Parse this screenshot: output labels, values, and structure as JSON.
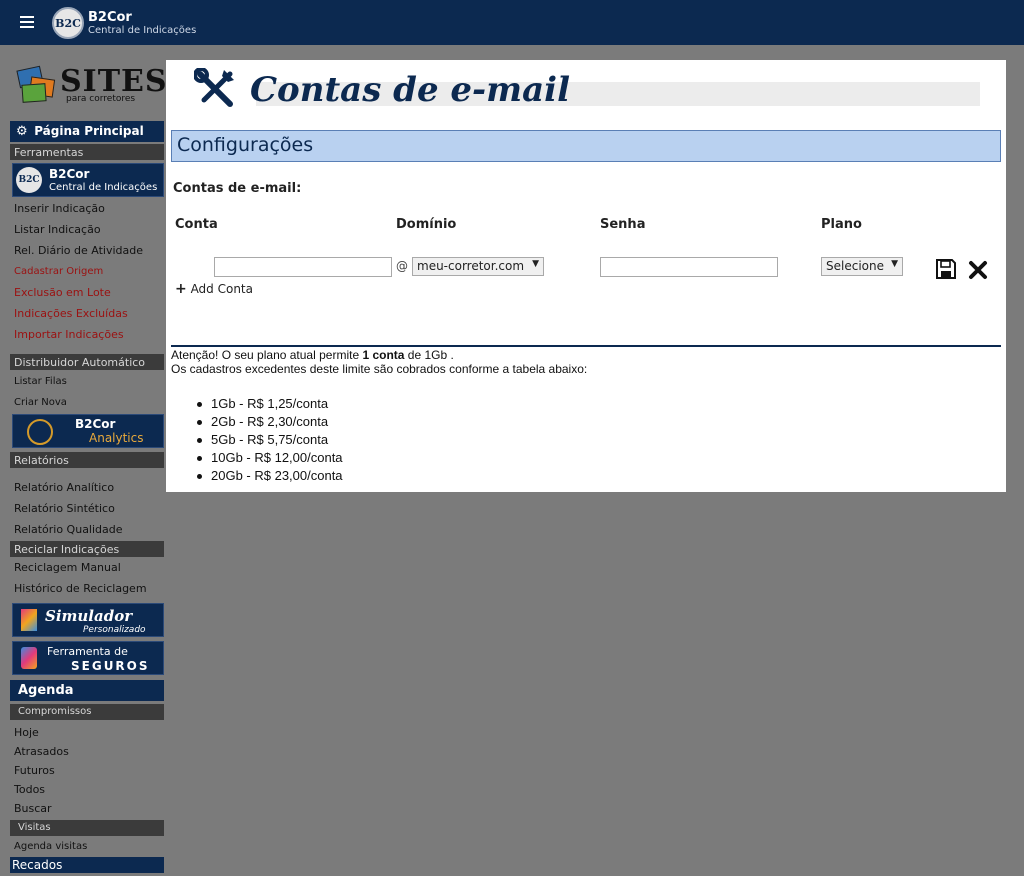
{
  "topbar": {
    "brand_title": "B2Cor",
    "brand_subtitle": "Central de Indicações",
    "logo_text": "B2C"
  },
  "sidebar": {
    "logo_word": "SITES",
    "logo_sub": "para corretores",
    "main_page": "Página Principal",
    "tools_header": "Ferramentas",
    "b2cor_banner": {
      "title": "B2Cor",
      "subtitle": "Central de Indicações",
      "logo_text": "B2C"
    },
    "tools_links": [
      "Inserir Indicação",
      "Listar Indicação",
      "Rel. Diário de Atividade"
    ],
    "red_links": [
      "Cadastrar Origem",
      "Exclusão em Lote",
      "Indicações Excluídas",
      "Importar Indicações"
    ],
    "distrib_header": "Distribuidor Automático",
    "distrib_links": [
      "Listar Filas",
      "Criar Nova"
    ],
    "analytics_banner": {
      "title": "B2Cor",
      "subtitle": "Analytics"
    },
    "reports_header": "Relatórios",
    "reports_links": [
      "Relatório Analítico",
      "Relatório Sintético",
      "Relatório Qualidade"
    ],
    "recycle_header": "Reciclar Indicações",
    "recycle_links": [
      "Reciclagem Manual",
      "Histórico de Reciclagem"
    ],
    "simulator_banner": {
      "title": "Simulador",
      "subtitle": "Personalizado"
    },
    "insurance_banner": {
      "title": "Ferramenta de",
      "subtitle": "SEGUROS"
    },
    "agenda_header": "Agenda",
    "commitments_header": "Compromissos",
    "agenda_links": [
      "Hoje",
      "Atrasados",
      "Futuros",
      "Todos",
      "Buscar"
    ],
    "visits_header": "Visitas",
    "visits_link": "Agenda visitas",
    "messages_header": "Recados"
  },
  "main": {
    "title": "Contas de e-mail",
    "section": "Configurações",
    "form_label": "Contas de e-mail:",
    "columns": [
      "Conta",
      "Domínio",
      "Senha",
      "Plano"
    ],
    "at_sign": "@",
    "account_value": "",
    "domain_value": "meu-corretor.com",
    "password_value": "",
    "plan_value": "Selecione",
    "add_account": "Add Conta",
    "notice_prefix": "Atenção! O seu plano atual permite ",
    "notice_bold": "1 conta",
    "notice_suffix": " de 1Gb .",
    "notice_line2": "Os cadastros excedentes deste limite são cobrados conforme a tabela abaixo:",
    "prices": [
      "1Gb - R$ 1,25/conta",
      "2Gb - R$ 2,30/conta",
      "5Gb - R$ 5,75/conta",
      "10Gb - R$ 12,00/conta",
      "20Gb - R$ 23,00/conta"
    ]
  },
  "colors": {
    "navy": "#0c2950",
    "section_bg": "#b9d1f0",
    "red_link": "#9b1111",
    "page_bg": "#7b7b7b"
  }
}
